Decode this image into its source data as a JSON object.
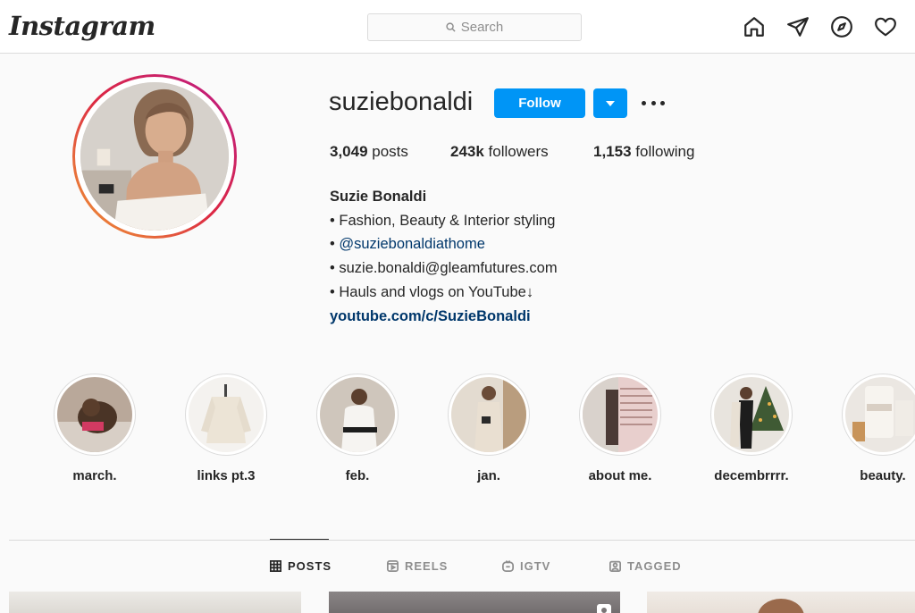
{
  "header": {
    "logo": "Instagram",
    "search_placeholder": "Search"
  },
  "profile": {
    "username": "suziebonaldi",
    "follow_label": "Follow",
    "stats": {
      "posts_count": "3,049",
      "posts_label": " posts",
      "followers_count": "243k",
      "followers_label": " followers",
      "following_count": "1,153",
      "following_label": " following"
    },
    "bio": {
      "name": "Suzie Bonaldi",
      "line1": "• Fashion, Beauty & Interior styling",
      "line2_bullet": "• ",
      "line2_mention": "@suziebonaldiathome",
      "line3": "• suzie.bonaldi@gleamfutures.com",
      "line4": "• Hauls and vlogs on YouTube↓",
      "link": "youtube.com/c/SuzieBonaldi"
    }
  },
  "highlights": [
    {
      "label": "march."
    },
    {
      "label": "links pt.3"
    },
    {
      "label": "feb."
    },
    {
      "label": "jan."
    },
    {
      "label": "about me."
    },
    {
      "label": "decembrrrr."
    },
    {
      "label": "beauty."
    }
  ],
  "tabs": [
    {
      "label": "POSTS",
      "icon": "grid-icon",
      "active": true
    },
    {
      "label": "REELS",
      "icon": "reels-icon",
      "active": false
    },
    {
      "label": "IGTV",
      "icon": "igtv-icon",
      "active": false
    },
    {
      "label": "TAGGED",
      "icon": "tagged-icon",
      "active": false
    }
  ],
  "colors": {
    "accent": "#0095f6",
    "link": "#00376b",
    "border": "#dbdbdb",
    "background": "#fafafa"
  }
}
